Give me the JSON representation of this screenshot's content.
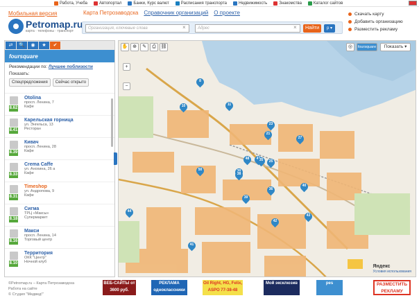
{
  "topbar": {
    "links": [
      {
        "label": "Работа, Учеба",
        "color": "#e8641b"
      },
      {
        "label": "Автопортал",
        "color": "#d33"
      },
      {
        "label": "Банки, Курс валют",
        "color": "#2a75c0"
      },
      {
        "label": "Расписания транспорта",
        "color": "#1a7fc0"
      },
      {
        "label": "Недвижимость",
        "color": "#2a75c0"
      },
      {
        "label": "Знакомства",
        "color": "#d33"
      },
      {
        "label": "Каталог сайтов",
        "color": "#2a9c4a"
      }
    ]
  },
  "header": {
    "mobile_link": "Мобильная версия",
    "logo_text": "Petromap.ru",
    "logo_sub": "карта · телефоны · транспорт",
    "nav": [
      "Карта Петрозаводска",
      "Справочник организаций",
      "О проекте"
    ],
    "search_placeholder": "Организация, ключевые слова",
    "address_placeholder": "Адрес",
    "find_button": "Найти",
    "region_button": "р ▾",
    "right_links": [
      "Скачать карту",
      "Добавить организацию",
      "Разместить рекламу"
    ]
  },
  "sidebar": {
    "tabs": [
      "⇄",
      "🔍",
      "◉",
      "★",
      "✔"
    ],
    "foursquare_title": "foursquare",
    "recommend_label": "Рекомендации по:",
    "recommend_value": "Лучшее поблизости",
    "show_label": "Показать:",
    "filter_buttons": [
      "Спецпредложения",
      "Сейчас открыто"
    ],
    "venues": [
      {
        "name": "Otolina",
        "address": "просп. Ленина, 7",
        "category": "Кафе",
        "score": "8.62",
        "score_color": "#56a83b"
      },
      {
        "name": "Карельская горница",
        "address": "ул. Энгельса, 13",
        "category": "Ресторан",
        "score": "8.41",
        "score_color": "#56a83b"
      },
      {
        "name": "Кивач",
        "address": "просп. Ленина, 28",
        "category": "Кафе",
        "score": "8.39",
        "score_color": "#56a83b"
      },
      {
        "name": "Crema Caffe",
        "address": "ул. Анохина, 26 а",
        "category": "Кафе",
        "score": "8.33",
        "score_color": "#56a83b"
      },
      {
        "name": "Timeshop",
        "address": "ул. Андропова, 9",
        "category": "Кафе",
        "score": "8.31",
        "score_color": "#56a83b"
      },
      {
        "name": "Сигма",
        "address": "ТРЦ «Максы»",
        "category": "Супермаркет",
        "score": "8.18",
        "score_color": "#56a83b"
      },
      {
        "name": "Макси",
        "address": "просп. Ленина, 14",
        "category": "Торговый центр",
        "score": "8.16",
        "score_color": "#56a83b"
      },
      {
        "name": "Территория",
        "address": "ОКК \"Центр\"",
        "category": "Ночной клуб",
        "score": "8.10",
        "score_color": "#56a83b"
      }
    ]
  },
  "map": {
    "foursquare_badge": "foursquare",
    "show_button": "Показать ▾",
    "yandex": "Яндекс",
    "terms": "Условия использования",
    "pins": [
      "8",
      "10",
      "11",
      "27",
      "23",
      "21",
      "25",
      "30",
      "50",
      "38",
      "47",
      "48",
      "36",
      "39",
      "40",
      "44",
      "42",
      "43",
      "35",
      "41"
    ]
  },
  "footer": {
    "copyright": "©Petromap.ru – Карта Петрозаводска",
    "links": [
      "Работа на сайте",
      "© Студия \"Медвед!\""
    ],
    "ads": [
      {
        "text": "ВЕБ-САЙТЫ от 3600 руб.",
        "bg": "#8a1b1b",
        "color": "#fff"
      },
      {
        "text": "РЕКЛАМА одноклассники",
        "bg": "#1f66b5",
        "color": "#fff"
      },
      {
        "text": "Oil Right, HG, Felix, ASPO 77-38-48",
        "bg": "#f4e04a",
        "color": "#d32"
      },
      {
        "text": "Мой эксклюзив",
        "bg": "#1c2b5e",
        "color": "#fff"
      },
      {
        "text": "pes",
        "bg": "#3d8fd0",
        "color": "#fff"
      },
      {
        "text": "РАЗМЕСТИТЬ РЕКЛАМУ",
        "bg": "#fff",
        "color": "#d32"
      }
    ]
  }
}
